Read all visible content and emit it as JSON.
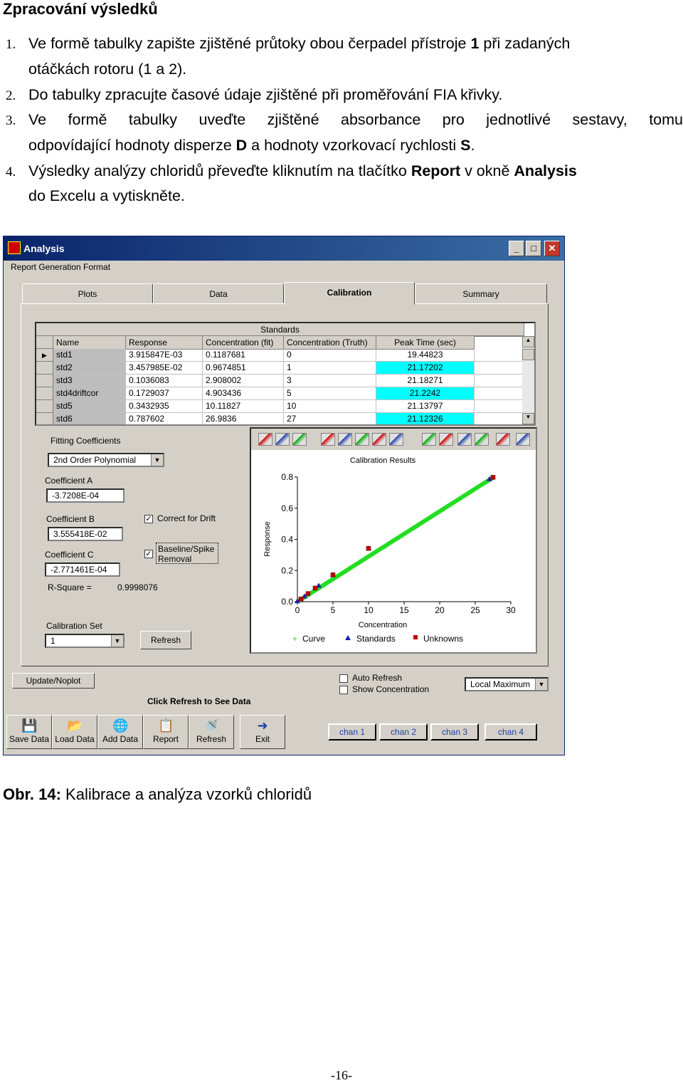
{
  "heading": "Zpracování výsledků",
  "items": [
    {
      "num": "1.",
      "line1_pre": "Ve formě tabulky zapište zjištěné průtoky obou čerpadel přístroje ",
      "line1_bold": "1",
      "line1_post": " při zadaných",
      "line2": "otáčkách rotoru (1 a 2)."
    },
    {
      "num": "2.",
      "line1": "Do tabulky zpracujte časové údaje zjištěné při proměřování FIA křivky."
    },
    {
      "num": "3.",
      "line1": "Ve formě tabulky uveďte zjištěné absorbance pro jednotlivé sestavy, tomu",
      "line2_a": "odpovídající hodnoty disperze ",
      "line2_b": "D",
      "line2_c": " a hodnoty vzorkovací rychlosti ",
      "line2_d": "S",
      "line2_e": "."
    },
    {
      "num": "4.",
      "line1_a": "Výsledky analýzy chloridů převeďte kliknutím na tlačítko ",
      "line1_b": "Report",
      "line1_c": " v okně ",
      "line1_d": "Analysis",
      "line2": "do Excelu a vytiskněte."
    }
  ],
  "window": {
    "title": "Analysis",
    "menu": "Report Generation Format",
    "tabs": [
      "Plots",
      "Data",
      "Calibration",
      "Summary"
    ],
    "active_tab": "Calibration",
    "grid": {
      "title": "Standards",
      "columns": [
        "Name",
        "Response",
        "Concentration (fit)",
        "Concentration (Truth)",
        "Peak Time (sec)"
      ],
      "rows": [
        {
          "name": "std1",
          "response": "3.915847E-03",
          "fit": "0.1187681",
          "truth": "0",
          "peak": "19.44823",
          "hl": false
        },
        {
          "name": "std2",
          "response": "3.457985E-02",
          "fit": "0.9674851",
          "truth": "1",
          "peak": "21.17202",
          "hl": true
        },
        {
          "name": "std3",
          "response": "0.1036083",
          "fit": "2.908002",
          "truth": "3",
          "peak": "21.18271",
          "hl": false
        },
        {
          "name": "std4driftcor",
          "response": "0.1729037",
          "fit": "4.903436",
          "truth": "5",
          "peak": "21.2242",
          "hl": true
        },
        {
          "name": "std5",
          "response": "0.3432935",
          "fit": "10.11827",
          "truth": "10",
          "peak": "21.13797",
          "hl": false
        },
        {
          "name": "std6",
          "response": "0.787602",
          "fit": "26.9836",
          "truth": "27",
          "peak": "21.12326",
          "hl": true
        }
      ]
    },
    "fitting": {
      "label": "Fitting Coefficients",
      "model": "2nd Order Polynomial",
      "coef_a_label": "Coefficient A",
      "coef_a": "-3.7208E-04",
      "coef_b_label": "Coefficient B",
      "coef_b": "3.555418E-02",
      "coef_c_label": "Coefficient C",
      "coef_c": "-2.771461E-04",
      "rsq_label": "R-Square =",
      "rsq": "0.9998076",
      "correct_drift": "Correct for Drift",
      "baseline1": "Baseline/Spike",
      "baseline2": "Removal",
      "calset_label": "Calibration Set",
      "calset": "1",
      "refresh": "Refresh"
    },
    "update_btn": "Update/Noplot",
    "auto_refresh": "Auto Refresh",
    "show_conc": "Show Concentration",
    "method": "Local Maximum",
    "click_refresh": "Click Refresh to See Data",
    "buttons": [
      "Save Data",
      "Load Data",
      "Add Data",
      "Report",
      "Refresh",
      "Exit"
    ],
    "channels": [
      "chan 1",
      "chan 2",
      "chan 3",
      "chan 4"
    ]
  },
  "chart_data": {
    "type": "scatter",
    "title": "Calibration Results",
    "xlabel": "Concentration",
    "ylabel": "Response",
    "xlim": [
      0,
      30
    ],
    "ylim": [
      0,
      0.8
    ],
    "xticks": [
      "0",
      "5",
      "10",
      "15",
      "20",
      "25",
      "30"
    ],
    "yticks": [
      "0.0",
      "0.2",
      "0.4",
      "0.6",
      "0.8"
    ],
    "legend": [
      "Curve",
      "Standards",
      "Unknowns"
    ],
    "colors": {
      "curve": "#22dd22",
      "standards": "#1f1fa8",
      "unknowns": "#c00000"
    },
    "coefficients": {
      "a": -0.00037208,
      "b": 0.03555418,
      "c": -0.0002771461
    },
    "standards": [
      {
        "x": 0,
        "y": 0.0039
      },
      {
        "x": 1,
        "y": 0.0346
      },
      {
        "x": 3,
        "y": 0.1036
      },
      {
        "x": 5,
        "y": 0.1729
      },
      {
        "x": 10,
        "y": 0.3433
      },
      {
        "x": 27,
        "y": 0.7876
      }
    ],
    "unknowns": [
      {
        "x": 0.5,
        "y": 0.017
      },
      {
        "x": 1.5,
        "y": 0.052
      },
      {
        "x": 2.5,
        "y": 0.087
      },
      {
        "x": 5,
        "y": 0.172
      },
      {
        "x": 10,
        "y": 0.342
      },
      {
        "x": 27.5,
        "y": 0.798
      }
    ]
  },
  "caption_bold": "Obr. 14:",
  "caption": " Kalibrace a analýza vzorků chloridů",
  "page_number": "-16-"
}
